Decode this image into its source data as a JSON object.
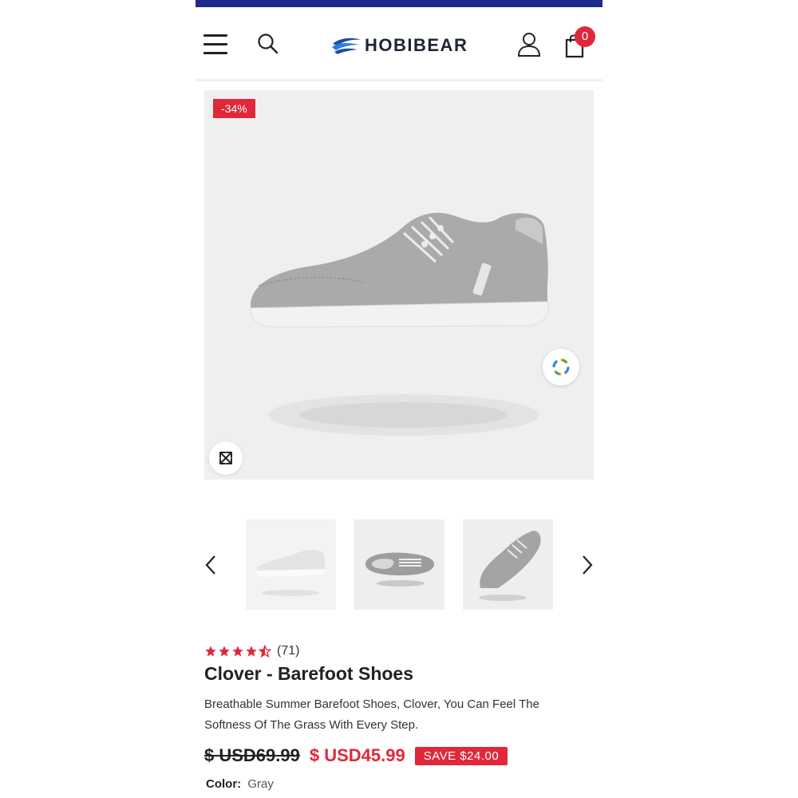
{
  "header": {
    "brand": "HOBIBEAR",
    "cart_count": "0",
    "icons": [
      "menu-icon",
      "search-icon",
      "user-icon",
      "shopping-bag-icon"
    ]
  },
  "colors": {
    "topbar": "#1f2a8c",
    "accent": "#e0283a",
    "star": "#e0283a"
  },
  "gallery": {
    "discount": "-34%",
    "thumbnails": [
      "thumbnail-1",
      "thumbnail-2",
      "thumbnail-3"
    ]
  },
  "product": {
    "rating": 4.5,
    "review_count": "(71)",
    "title": "Clover - Barefoot Shoes",
    "description": "Breathable Summer Barefoot Shoes, Clover, You Can Feel The Softness Of The Grass With Every Step.",
    "compare_price": "$ USD69.99",
    "price": "$ USD45.99",
    "save": "SAVE $24.00",
    "color_label": "Color:",
    "color_value": "Gray"
  }
}
